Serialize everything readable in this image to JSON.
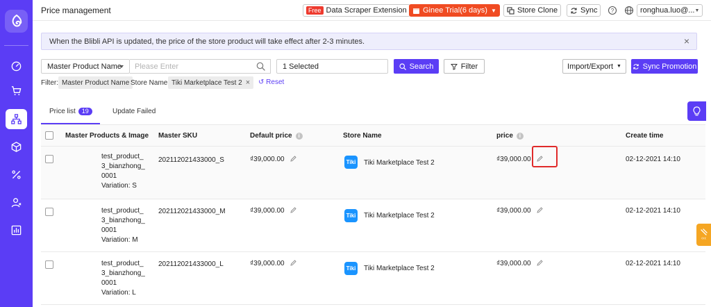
{
  "app": {
    "page_title": "Price management"
  },
  "topbar": {
    "free_badge": "Free",
    "scraper_label": "Data Scraper Extension",
    "trial_label": "Ginee Trial(6 days)",
    "store_clone_label": "Store Clone",
    "sync_label": "Sync",
    "user_label": "ronghua.luo@..."
  },
  "notice": {
    "text": "When the Blibli API is updated, the price of the store product will take effect after 2-3 minutes."
  },
  "search": {
    "field_select": "Master Product Name",
    "placeholder": "Please Enter",
    "store_select": "1 Selected",
    "search_label": "Search",
    "filter_label": "Filter",
    "import_export_label": "Import/Export",
    "sync_promotion_label": "Sync Promotion"
  },
  "filters": {
    "label": "Filter:",
    "chip1": "Master Product Name",
    "store_label": "Store Name:",
    "store_value": "Tiki Marketplace Test 2",
    "reset_label": "Reset"
  },
  "tabs": [
    {
      "label": "Price list",
      "count": "19"
    },
    {
      "label": "Update Failed"
    }
  ],
  "table": {
    "headers": {
      "product": "Master Products & Image",
      "sku": "Master SKU",
      "default_price": "Default price",
      "store": "Store Name",
      "price": "price",
      "create_time": "Create time"
    },
    "rows": [
      {
        "name_l1": "test_product_",
        "name_l2": "3_bianzhong_",
        "name_l3": "0001",
        "variation": "Variation: S",
        "sku": "202112021433000_S",
        "default_price": "₫39,000.00",
        "store_logo": "Tiki",
        "store": "Tiki Marketplace Test 2",
        "price": "₫39,000.00",
        "created": "02-12-2021 14:10"
      },
      {
        "name_l1": "test_product_",
        "name_l2": "3_bianzhong_",
        "name_l3": "0001",
        "variation": "Variation: M",
        "sku": "202112021433000_M",
        "default_price": "₫39,000.00",
        "store_logo": "Tiki",
        "store": "Tiki Marketplace Test 2",
        "price": "₫39,000.00",
        "created": "02-12-2021 14:10"
      },
      {
        "name_l1": "test_product_",
        "name_l2": "3_bianzhong_",
        "name_l3": "0001",
        "variation": "Variation: L",
        "sku": "202112021433000_L",
        "default_price": "₫39,000.00",
        "store_logo": "Tiki",
        "store": "Tiki Marketplace Test 2",
        "price": "₫39,000.00",
        "created": "02-12-2021 14:10"
      }
    ]
  },
  "colors": {
    "brand": "#5b3df5",
    "trial": "#f04b22",
    "highlight_box": "#e02a2a",
    "tiki": "#1a94ff",
    "side_tab": "#f5a623"
  },
  "icons": [
    "logo-icon",
    "dashboard-icon",
    "cart-icon",
    "sitemap-icon",
    "box-icon",
    "percent-icon",
    "users-icon",
    "chart-icon",
    "calendar-icon",
    "store-clone-icon",
    "sync-icon",
    "help-icon",
    "globe-icon",
    "search-icon",
    "filter-icon",
    "reset-icon",
    "pencil-icon",
    "lightbulb-icon"
  ]
}
